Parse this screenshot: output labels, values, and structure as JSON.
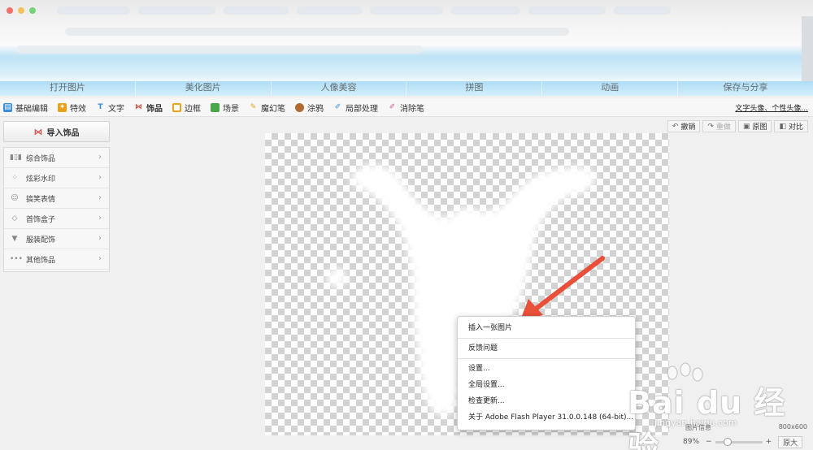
{
  "main_tabs": [
    "打开图片",
    "美化图片",
    "人像美容",
    "拼图",
    "动画",
    "保存与分享"
  ],
  "toolbar": {
    "tools": [
      {
        "label": "基础编辑",
        "icon": "basic-edit-icon",
        "color": "#3a8fd8"
      },
      {
        "label": "特效",
        "icon": "magic-wand-icon",
        "color": "#e8a21c"
      },
      {
        "label": "文字",
        "icon": "text-t-icon",
        "color": "#3a8fd8"
      },
      {
        "label": "饰品",
        "icon": "bow-tie-icon",
        "color": "#e0463c"
      },
      {
        "label": "边框",
        "icon": "frame-icon",
        "color": "#e8a21c"
      },
      {
        "label": "场景",
        "icon": "scene-icon",
        "color": "#4aa64a"
      },
      {
        "label": "魔幻笔",
        "icon": "magic-pen-icon",
        "color": "#e8a21c"
      },
      {
        "label": "涂鸦",
        "icon": "paint-palette-icon",
        "color": "#b06a32"
      },
      {
        "label": "局部处理",
        "icon": "brush-icon",
        "color": "#3a8fd8"
      },
      {
        "label": "消除笔",
        "icon": "eraser-icon",
        "color": "#d06090"
      }
    ],
    "right_link": "文字头像、个性头像..."
  },
  "left_panel": {
    "import_label": "导入饰品",
    "categories": [
      {
        "label": "综合饰品",
        "icon": "bars-icon"
      },
      {
        "label": "炫彩水印",
        "icon": "sparkle-icon"
      },
      {
        "label": "搞笑表情",
        "icon": "faces-icon"
      },
      {
        "label": "首饰盒子",
        "icon": "diamond-icon"
      },
      {
        "label": "服装配饰",
        "icon": "shirt-icon"
      },
      {
        "label": "其他饰品",
        "icon": "dots-icon"
      }
    ]
  },
  "actions": {
    "undo": "撤销",
    "redo": "重做",
    "original": "原图",
    "compare": "对比"
  },
  "context_menu": {
    "items": [
      "插入一张图片",
      "反馈问题",
      "设置...",
      "全局设置...",
      "检查更新...",
      "关于 Adobe Flash Player 31.0.0.148 (64-bit)..."
    ]
  },
  "status": {
    "image_size_label": "图片信息",
    "image_size": "800x600",
    "zoom": "89%",
    "zoom_value": 0.2,
    "fit_label": "原大"
  },
  "watermark": {
    "main": "Bai du 经验",
    "sub": "jingyan.baidu.com"
  },
  "colors": {
    "arrow": "#e8503a",
    "tab_band": "#b9e2f7"
  }
}
